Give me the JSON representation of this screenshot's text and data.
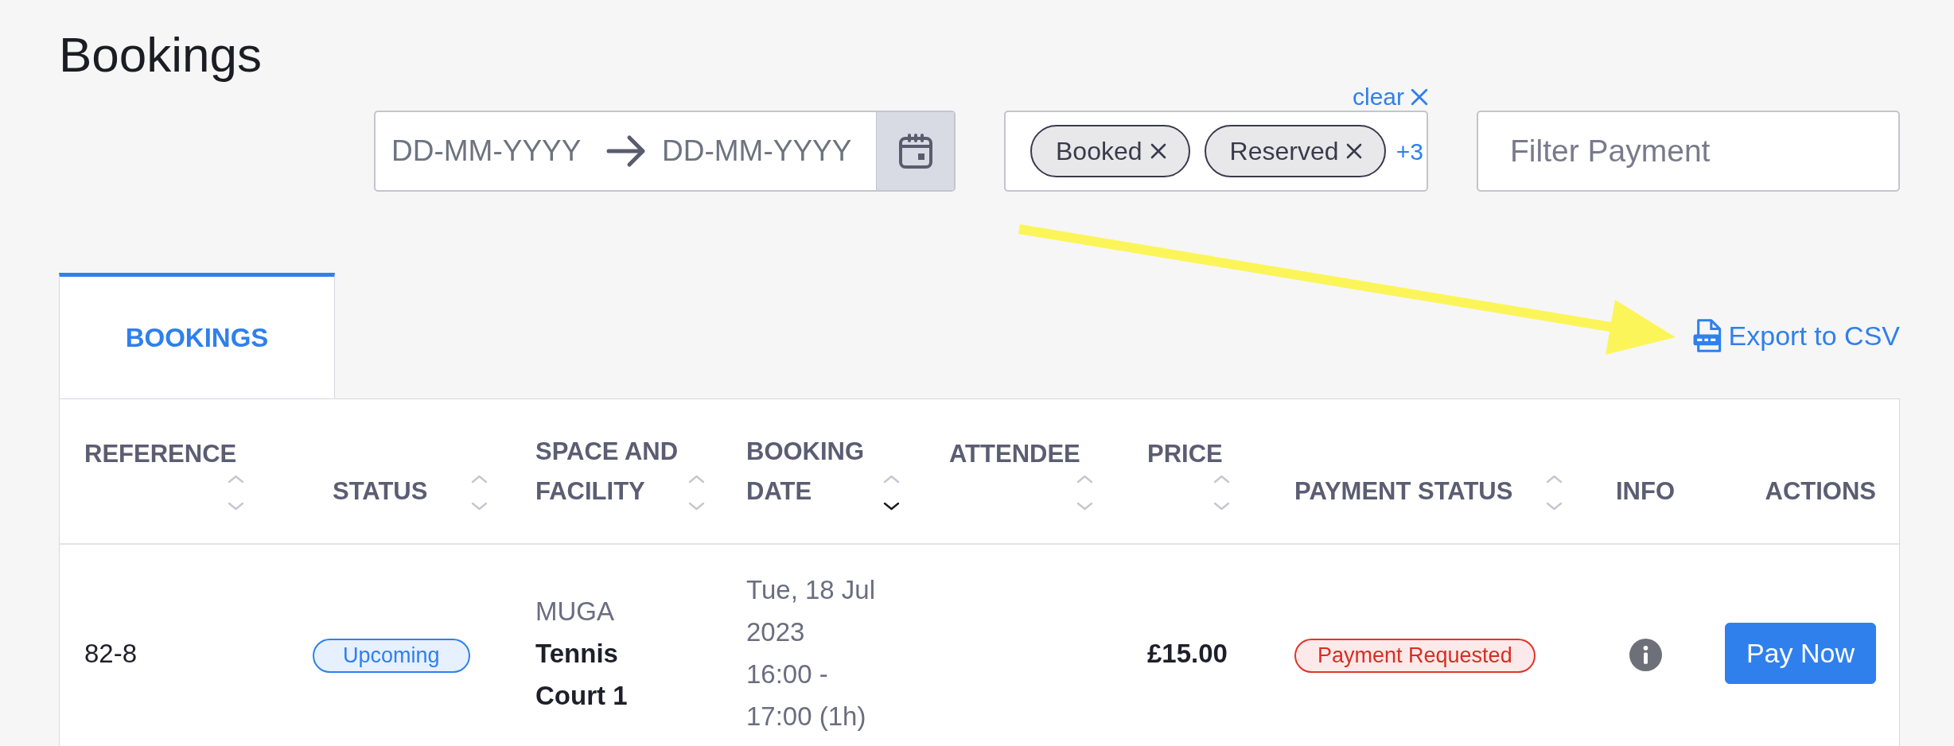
{
  "page": {
    "title": "Bookings"
  },
  "filters": {
    "date_range": {
      "start_placeholder": "DD-MM-YYYY",
      "end_placeholder": "DD-MM-YYYY"
    },
    "status": {
      "clear_label": "clear",
      "chips": [
        {
          "label": "Booked"
        },
        {
          "label": "Reserved"
        }
      ],
      "more_count": "+3"
    },
    "payment": {
      "placeholder": "Filter Payment"
    }
  },
  "tabs": [
    {
      "label": "BOOKINGS",
      "selected": true
    }
  ],
  "export_label": "Export to CSV",
  "table": {
    "columns": [
      {
        "label": "REFERENCE",
        "sortable": true,
        "ascending": false,
        "descending": false
      },
      {
        "label": "STATUS",
        "sortable": true,
        "ascending": false,
        "descending": false
      },
      {
        "label": "SPACE AND FACILITY",
        "sortable": true,
        "ascending": false,
        "descending": false
      },
      {
        "label": "BOOKING DATE",
        "sortable": true,
        "ascending": false,
        "descending": true
      },
      {
        "label": "ATTENDEE",
        "sortable": true,
        "ascending": false,
        "descending": false
      },
      {
        "label": "PRICE",
        "sortable": true,
        "ascending": false,
        "descending": false
      },
      {
        "label": "PAYMENT STATUS",
        "sortable": true,
        "ascending": false,
        "descending": false
      },
      {
        "label": "INFO",
        "sortable": false
      },
      {
        "label": "ACTIONS",
        "sortable": false
      }
    ],
    "rows": [
      {
        "reference": "82-8",
        "status": "Upcoming",
        "space": "MUGA",
        "facility": "Tennis Court 1",
        "date": "Tue, 18 Jul 2023",
        "time": "16:00 - 17:00 (1h)",
        "price": "£15.00",
        "payment_status": "Payment Requested",
        "action": "Pay Now"
      }
    ]
  }
}
